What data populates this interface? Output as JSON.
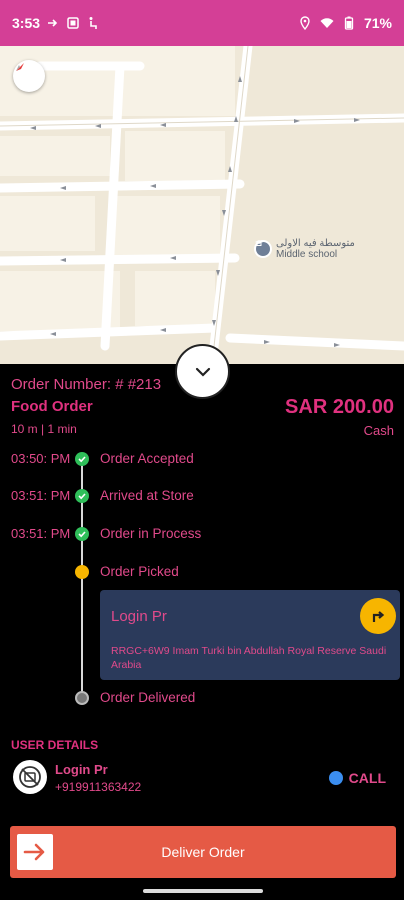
{
  "status_bar": {
    "time": "3:53",
    "battery": "71%",
    "icons": [
      "cast-arrow-icon",
      "screenshot-icon",
      "accessibility-icon",
      "location-icon",
      "wifi-icon",
      "battery-icon"
    ]
  },
  "map": {
    "poi_arabic": "متوسطة فيه الاولى",
    "poi_label": "Middle school"
  },
  "order": {
    "number_label": "Order Number: # #213",
    "type": "Food Order",
    "eta": "10 m | 1 min",
    "price": "SAR 200.00",
    "payment": "Cash"
  },
  "timeline": [
    {
      "time": "03:50: PM",
      "label": "Order Accepted",
      "status": "done"
    },
    {
      "time": "03:51: PM",
      "label": "Arrived at Store",
      "status": "done"
    },
    {
      "time": "03:51: PM",
      "label": "Order in Process",
      "status": "done"
    },
    {
      "time": "",
      "label": "Order Picked",
      "status": "current"
    },
    {
      "time": "",
      "label": "Order Delivered",
      "status": "pending"
    }
  ],
  "address_card": {
    "name": "Login Pr",
    "address": "RRGC+6W9 Imam Turki bin Abdullah Royal Reserve Saudi Arabia"
  },
  "user": {
    "section_title": "USER DETAILS",
    "name": "Login Pr",
    "phone": "+919911363422",
    "call_label": "CALL"
  },
  "action": {
    "deliver_label": "Deliver Order"
  },
  "colors": {
    "status_bar": "#d43f96",
    "accent_pink": "#e14a8b",
    "done_green": "#2fbf5a",
    "current_yellow": "#f7b500",
    "pending_gray": "#777777",
    "card_bg": "#2b3a5b",
    "deliver_button": "#e55a45",
    "call_blue": "#3b8ef0"
  }
}
